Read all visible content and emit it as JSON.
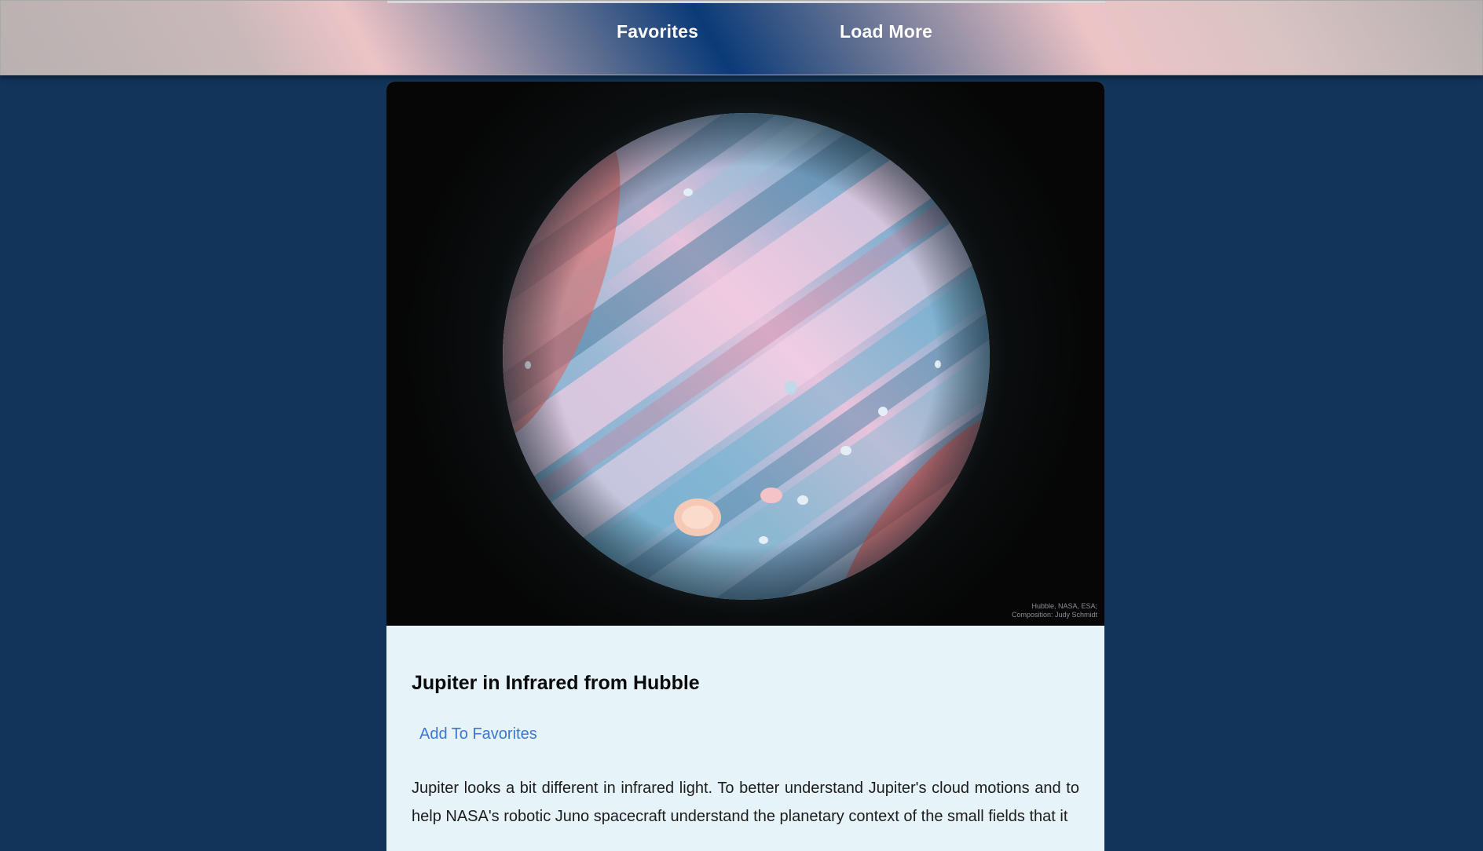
{
  "nav": {
    "favorites_label": "Favorites",
    "load_more_label": "Load More"
  },
  "post": {
    "image_alt": "Jupiter in Infrared from Hubble",
    "image_credit_line1": "Hubble, NASA, ESA;",
    "image_credit_line2": "Composition: Judy Schmidt",
    "title": "Jupiter in Infrared from Hubble",
    "add_favorite_label": "Add To Favorites",
    "description": "Jupiter looks a bit different in infrared light. To better understand Jupiter's cloud motions and to help NASA's robotic Juno spacecraft understand the planetary context of the small fields that it"
  },
  "colors": {
    "page_background": "#12335a",
    "card_background": "#e6f3f9",
    "link_blue": "#3b78d0",
    "nav_text": "#ffffff"
  }
}
